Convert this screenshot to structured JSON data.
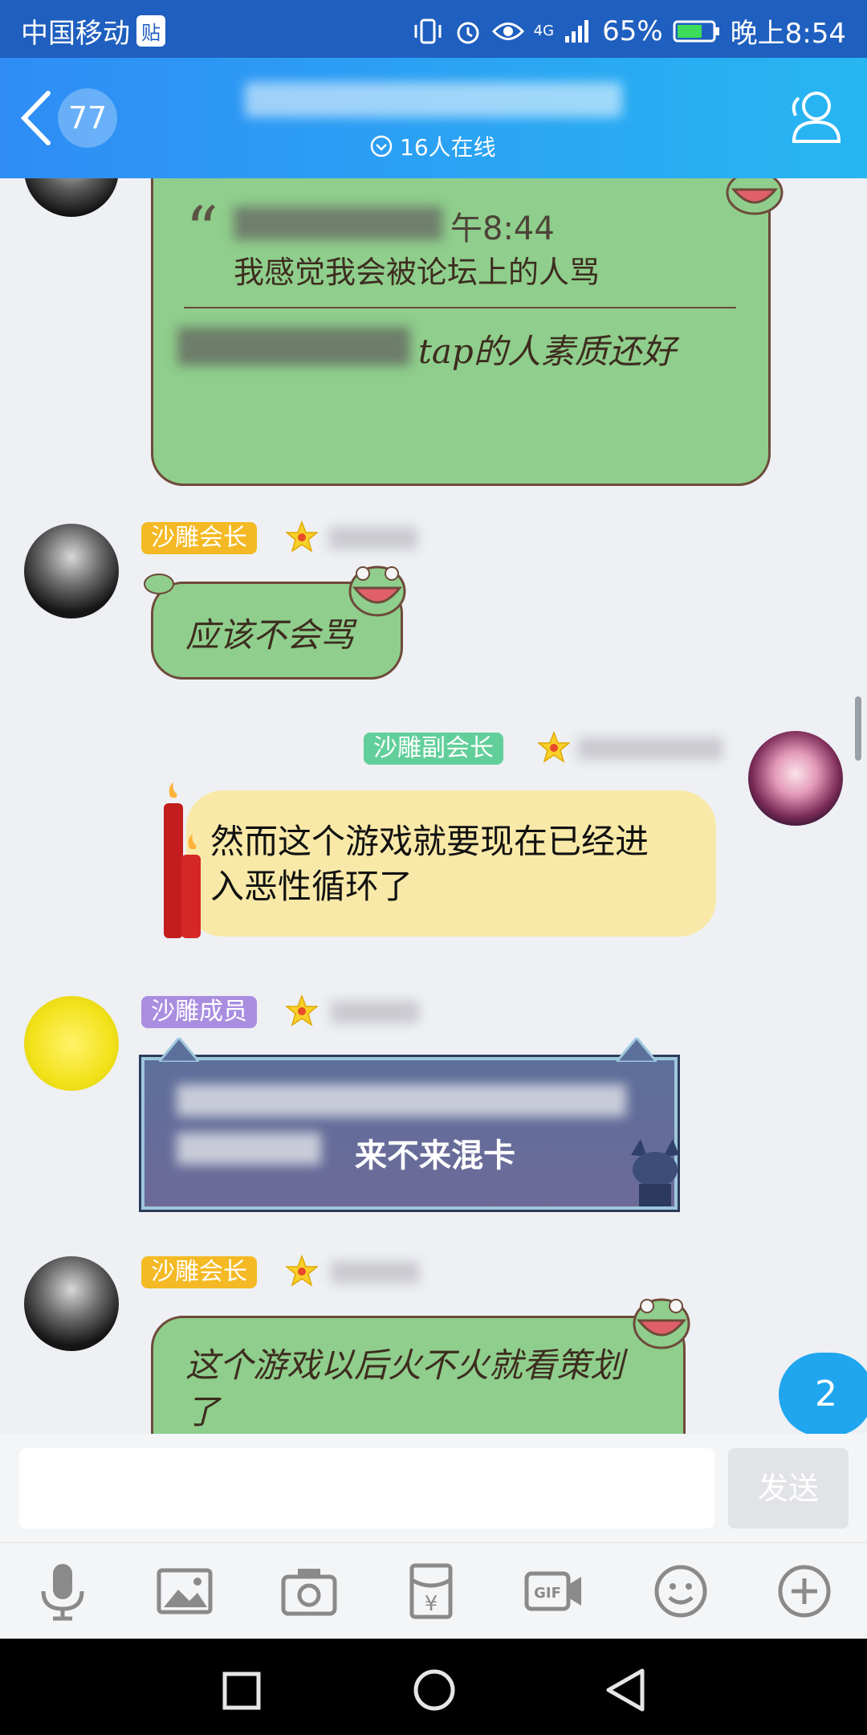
{
  "status_bar": {
    "carrier": "中国移动",
    "carrier_tag": "贴",
    "network": "4G",
    "battery": "65%",
    "time": "晚上8:54"
  },
  "header": {
    "back_count": "77",
    "group_name": "████ ████ ████",
    "online": "16人在线"
  },
  "messages": {
    "quote": {
      "quote_time": "午8:44",
      "quote_text": "我感觉我会被论坛上的人骂",
      "reply_text": "tap的人素质还好"
    },
    "m1": {
      "role": "沙雕会长",
      "text": "应该不会骂"
    },
    "m2": {
      "role": "沙雕副会长",
      "text": "然而这个游戏就要现在已经进入恶性循环了"
    },
    "m3": {
      "role": "沙雕成员",
      "text": "来不来混卡"
    },
    "m4": {
      "role": "沙雕会长",
      "text": "这个游戏以后火不火就看策划了"
    }
  },
  "unread_badge": "2",
  "input": {
    "placeholder": "",
    "send_label": "发送"
  },
  "colors": {
    "accent": "#2f8df5",
    "role_leader": "#f4b924",
    "role_vice": "#62cf9a",
    "role_member": "#a98ee0",
    "green_bubble": "#8fce8c",
    "yellow_bubble": "#f9e9a8"
  },
  "icons": [
    "back-icon",
    "members-icon",
    "chevron-down-icon",
    "mic-icon",
    "image-icon",
    "camera-icon",
    "red-packet-icon",
    "gif-icon",
    "emoji-icon",
    "plus-icon"
  ]
}
